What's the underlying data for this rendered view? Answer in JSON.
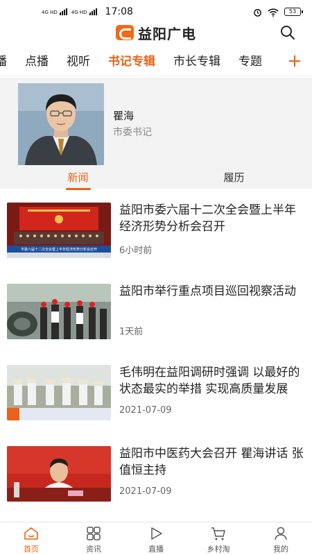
{
  "status_bar": {
    "network_1": "4G HD",
    "network_2": "4G HD",
    "time": "17:08",
    "battery": "53"
  },
  "header": {
    "logo_text": "益阳广电",
    "logo_icon": "yiyang-broadcast-logo",
    "search_icon": "search-icon"
  },
  "tabs": [
    {
      "label": "播"
    },
    {
      "label": "点播"
    },
    {
      "label": "视听"
    },
    {
      "label": "书记专辑",
      "active": true
    },
    {
      "label": "市长专辑"
    },
    {
      "label": "专题"
    }
  ],
  "add_tab_label": "+",
  "profile": {
    "name": "瞿海",
    "title": "市委书记",
    "subtabs": [
      {
        "label": "新闻",
        "active": true
      },
      {
        "label": "履历"
      }
    ]
  },
  "feed": [
    {
      "headline": "益阳市委六届十二次全会暨上半年经济形势分析会召开",
      "time": "6小时前",
      "thumb_caption": "市委六届十二次全会暨上半年经济形势分析会召开"
    },
    {
      "headline": "益阳市举行重点项目巡回视察活动",
      "time": "1天前"
    },
    {
      "headline": "毛伟明在益阳调研时强调 以最好的状态最实的举措 实现高质量发展",
      "time": "2021-07-09"
    },
    {
      "headline": "益阳市中医药大会召开 瞿海讲话 张值恒主持",
      "time": "2021-07-09"
    }
  ],
  "bottom_nav": [
    {
      "label": "首页",
      "icon": "home-icon",
      "active": true
    },
    {
      "label": "资讯",
      "icon": "grid-icon"
    },
    {
      "label": "直播",
      "icon": "play-icon"
    },
    {
      "label": "乡村淘",
      "icon": "cart-icon"
    },
    {
      "label": "我的",
      "icon": "user-icon"
    }
  ],
  "colors": {
    "accent": "#e9631a",
    "profile_bg": "#f3f3f3"
  }
}
